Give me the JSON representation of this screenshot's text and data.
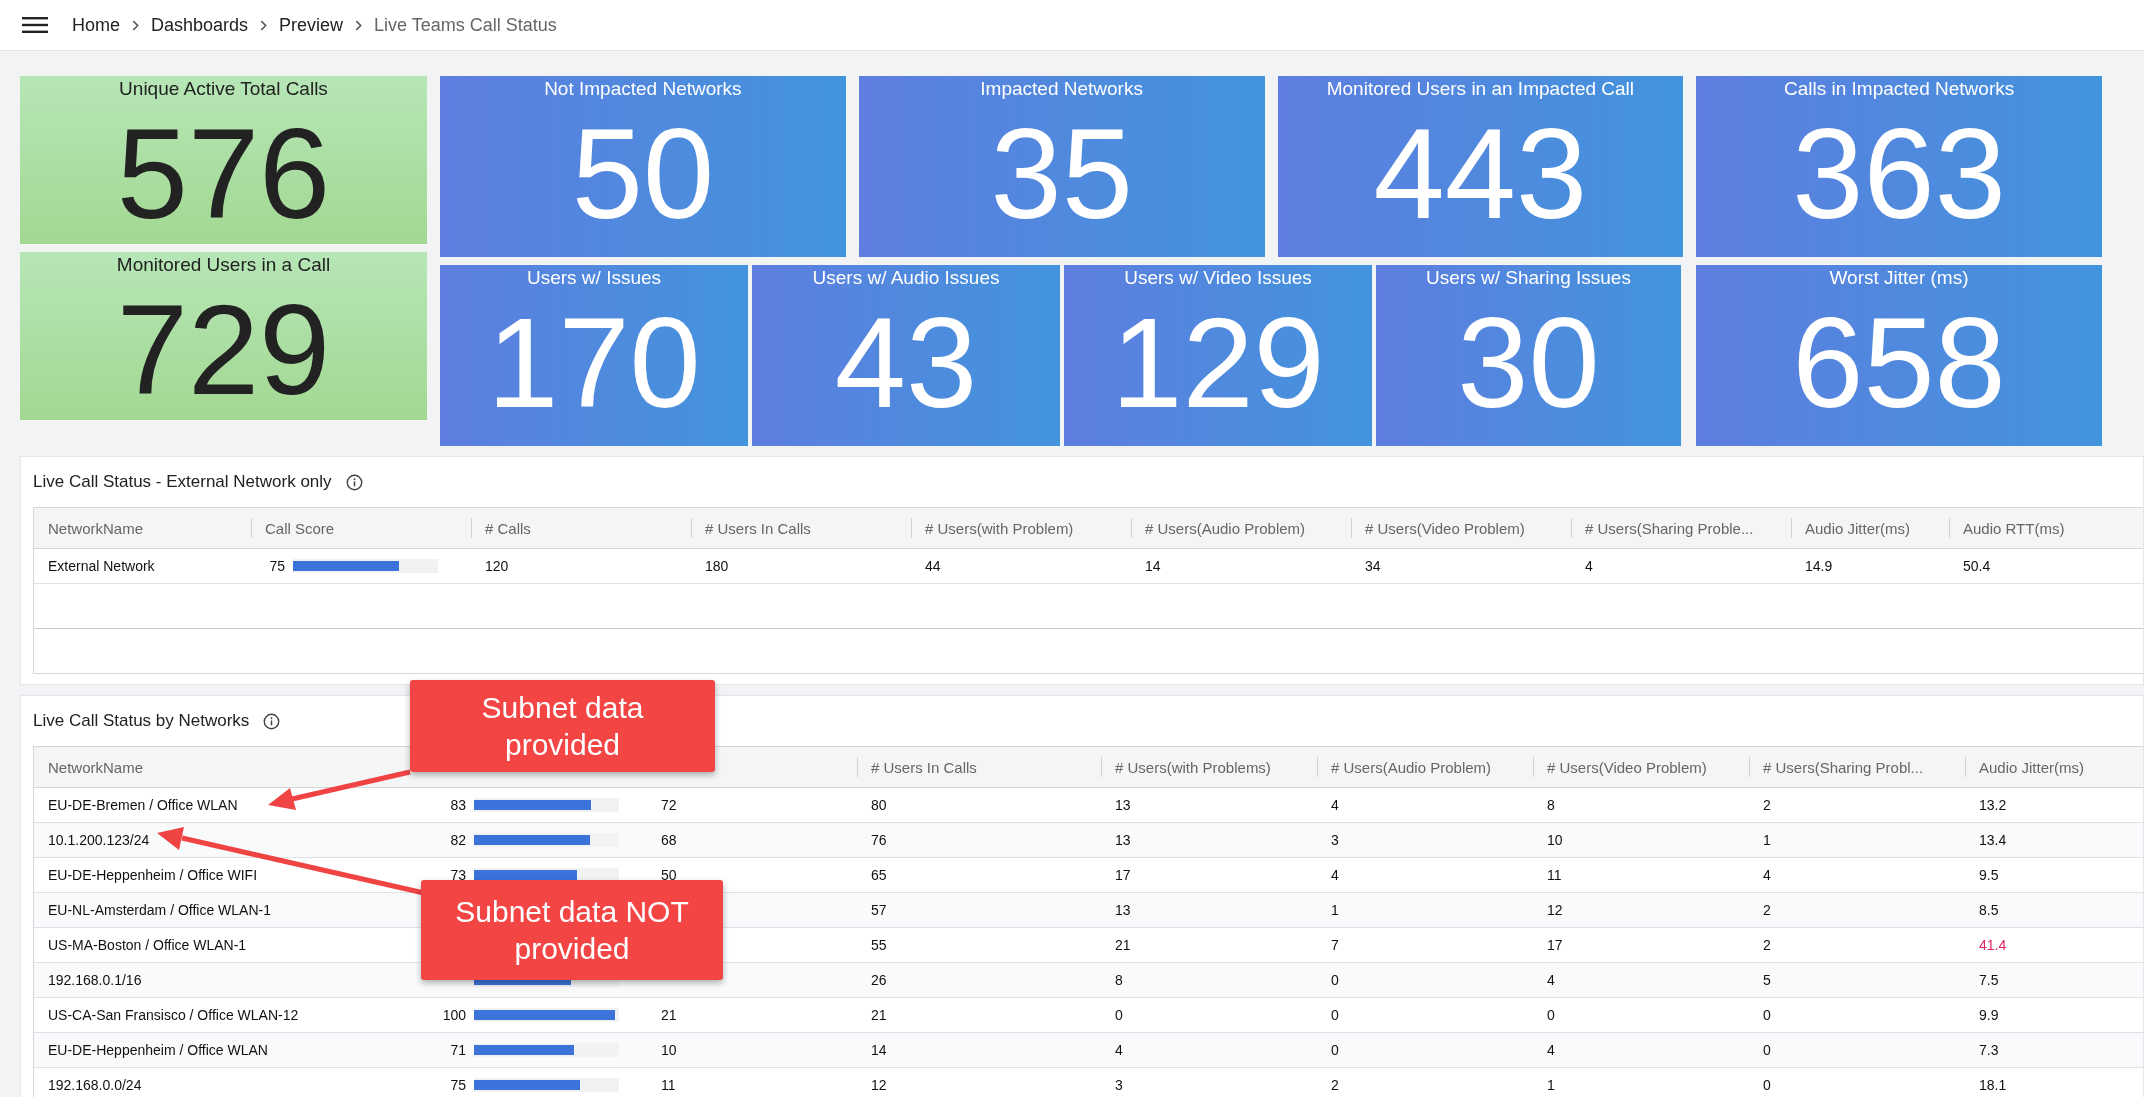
{
  "breadcrumb": [
    {
      "label": "Home",
      "current": false
    },
    {
      "label": "Dashboards",
      "current": false
    },
    {
      "label": "Preview",
      "current": false
    },
    {
      "label": "Live Teams Call Status",
      "current": true
    }
  ],
  "stat_tiles": {
    "left": [
      {
        "title": "Unique Active Total Calls",
        "value": "576",
        "kind": "green"
      },
      {
        "title": "Monitored Users in a Call",
        "value": "729",
        "kind": "green"
      }
    ],
    "top": [
      {
        "title": "Not Impacted Networks",
        "value": "50",
        "kind": "blue"
      },
      {
        "title": "Impacted Networks",
        "value": "35",
        "kind": "blue"
      },
      {
        "title": "Monitored Users in an Impacted Call",
        "value": "443",
        "kind": "blue"
      },
      {
        "title": "Calls in Impacted Networks",
        "value": "363",
        "kind": "blue"
      }
    ],
    "bottom": [
      {
        "title": "Users w/ Issues",
        "value": "170",
        "kind": "blue"
      },
      {
        "title": "Users w/ Audio Issues",
        "value": "43",
        "kind": "blue"
      },
      {
        "title": "Users w/ Video Issues",
        "value": "129",
        "kind": "blue"
      },
      {
        "title": "Users w/ Sharing Issues",
        "value": "30",
        "kind": "blue"
      },
      {
        "title": "Worst Jitter (ms)",
        "value": "658",
        "kind": "blue"
      }
    ]
  },
  "panels": [
    {
      "title": "Live Call Status - External Network only",
      "columns": [
        {
          "label": "NetworkName"
        },
        {
          "label": "Call Score"
        },
        {
          "label": "# Calls"
        },
        {
          "label": "# Users In Calls"
        },
        {
          "label": "# Users(with Problem)"
        },
        {
          "label": "# Users(Audio Problem)"
        },
        {
          "label": "# Users(Video Problem)"
        },
        {
          "label": "# Users(Sharing Proble..."
        },
        {
          "label": "Audio Jitter(ms)"
        },
        {
          "label": "Audio RTT(ms)"
        }
      ],
      "rows": [
        {
          "cells": [
            "External Network",
            {
              "kind": "score",
              "score": "75",
              "level": 0.75
            },
            "120",
            "180",
            "44",
            "14",
            "34",
            "4",
            "14.9",
            "50.4"
          ]
        }
      ]
    },
    {
      "title": "Live Call Status by Networks",
      "columns": [
        {
          "label": "NetworkName"
        },
        {},
        {},
        {
          "label": "# Users In Calls"
        },
        {
          "label": "# Users(with Problems)"
        },
        {
          "label": "# Users(Audio Problem)"
        },
        {
          "label": "# Users(Video Problem)"
        },
        {
          "label": "# Users(Sharing Probl..."
        },
        {
          "label": "Audio Jitter(ms)"
        }
      ],
      "rows": [
        {
          "cells": [
            "EU-DE-Bremen / Office WLAN",
            {
              "kind": "score",
              "score": "83",
              "level": 0.83
            },
            "72",
            "80",
            "13",
            "4",
            "8",
            "2",
            "13.2"
          ]
        },
        {
          "cells": [
            "10.1.200.123/24",
            {
              "kind": "score",
              "score": "82",
              "level": 0.82
            },
            "68",
            "76",
            "13",
            "3",
            "10",
            "1",
            "13.4"
          ]
        },
        {
          "cells": [
            "EU-DE-Heppenheim / Office WIFI",
            {
              "kind": "score",
              "score": "73",
              "level": 0.73
            },
            "50",
            "65",
            "17",
            "4",
            "11",
            "4",
            "9.5"
          ]
        },
        {
          "cells": [
            "EU-NL-Amsterdam / Office WLAN-1",
            {
              "kind": "score"
            },
            {
              "kind": "blank"
            },
            "57",
            "13",
            "1",
            "12",
            "2",
            "8.5"
          ]
        },
        {
          "cells": [
            "US-MA-Boston / Office WLAN-1",
            {
              "kind": "score"
            },
            {
              "kind": "blank"
            },
            "55",
            "21",
            "7",
            "17",
            "2",
            {
              "kind": "alert",
              "text": "41.4"
            }
          ]
        },
        {
          "cells": [
            "192.168.0.1/16",
            {
              "kind": "score",
              "level": 0.69
            },
            {
              "kind": "blank"
            },
            "26",
            "8",
            "0",
            "4",
            "5",
            "7.5"
          ]
        },
        {
          "cells": [
            "US-CA-San Fransisco / Office WLAN-12",
            {
              "kind": "score",
              "score": "100",
              "level": 1.0
            },
            "21",
            "21",
            "0",
            "0",
            "0",
            "0",
            "9.9"
          ]
        },
        {
          "cells": [
            "EU-DE-Heppenheim / Office WLAN",
            {
              "kind": "score",
              "score": "71",
              "level": 0.71
            },
            "10",
            "14",
            "4",
            "0",
            "4",
            "0",
            "7.3"
          ]
        },
        {
          "cells": [
            "192.168.0.0/24",
            {
              "kind": "score",
              "score": "75",
              "level": 0.75
            },
            "11",
            "12",
            "3",
            "2",
            "1",
            "0",
            "18.1"
          ]
        }
      ]
    }
  ],
  "callouts": [
    {
      "text": "Subnet data provided",
      "kind": "upper"
    },
    {
      "text": "Subnet data NOT provided",
      "kind": "lower"
    }
  ]
}
